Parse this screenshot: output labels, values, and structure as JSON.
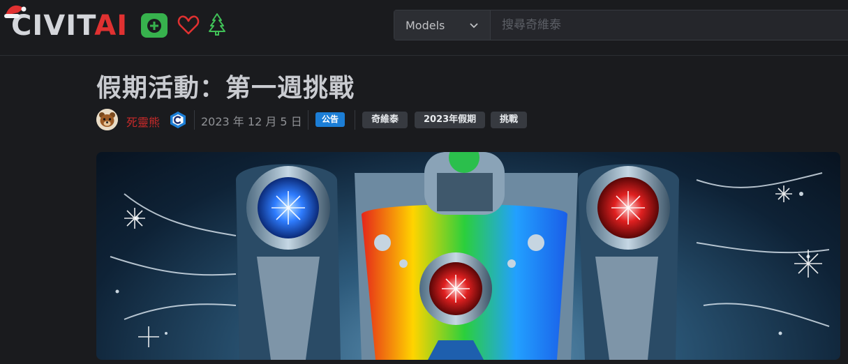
{
  "header": {
    "logo_main": "CIVIT",
    "logo_accent": "AI",
    "search": {
      "category": "Models",
      "placeholder": "搜尋奇維泰"
    }
  },
  "article": {
    "title": "假期活動：第一週挑戰",
    "author": "死靈熊",
    "date": "2023 年 12 月 5 日",
    "category_badge": "公告",
    "tags": [
      "奇維泰",
      "2023年假期",
      "挑戰"
    ]
  },
  "colors": {
    "background": "#1a1b1e",
    "accent_red": "#e03131",
    "add_green": "#37b24d",
    "announcement_blue": "#1c7ed6",
    "tag_bg": "#373a40"
  },
  "icons": [
    "santa-hat-icon",
    "plus-icon",
    "heart-icon",
    "christmas-tree-icon",
    "chevron-down-icon",
    "creator-badge-icon",
    "bear-avatar"
  ]
}
